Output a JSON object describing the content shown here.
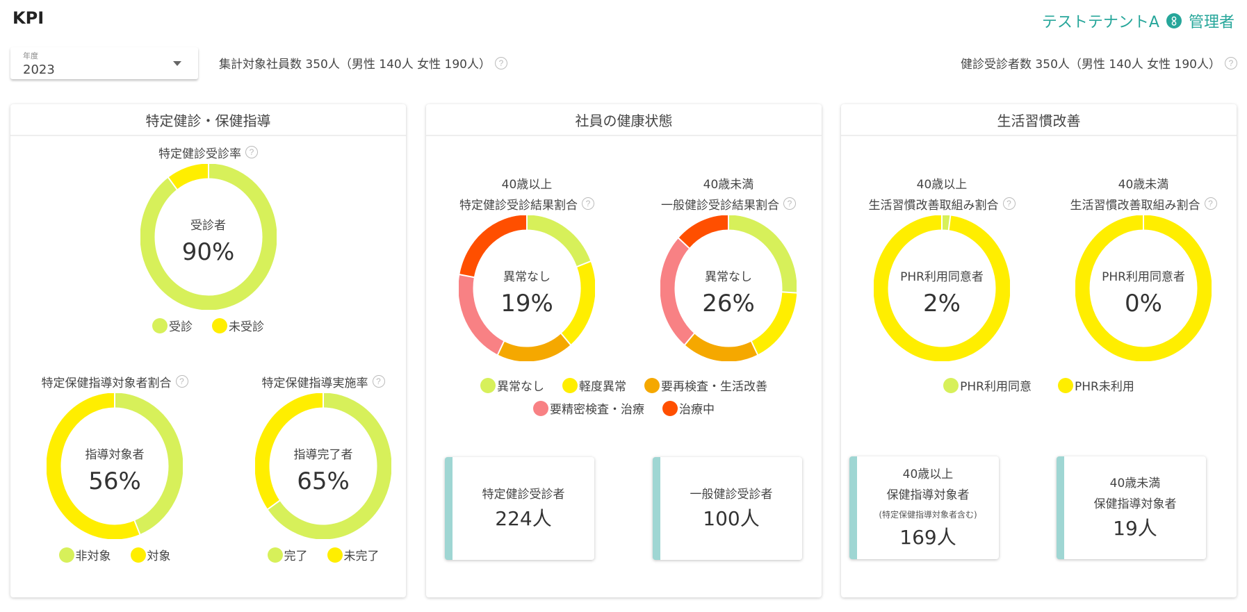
{
  "header": {
    "title": "KPI",
    "tenant": "テストテナントA",
    "role": "管理者",
    "accent_color": "#26a69a"
  },
  "year_select": {
    "label": "年度",
    "value": "2023"
  },
  "summary": {
    "target_employees": "集計対象社員数 350人（男性 140人 女性 190人）",
    "examinees": "健診受診者数 350人（男性 140人 女性 190人）"
  },
  "colors": {
    "normal": "#d7f05a",
    "mild": "#ffee00",
    "recheck": "#f5a800",
    "detailed": "#f88184",
    "treatment": "#ff4f00"
  },
  "panels": [
    {
      "title": "特定健診・保健指導",
      "charts": [
        {
          "title": "特定健診受診率",
          "center_label": "受診者",
          "center_value": "90%",
          "segments": [
            {
              "label": "受診",
              "value": 90,
              "color": "#d7f05a"
            },
            {
              "label": "未受診",
              "value": 10,
              "color": "#ffee00"
            }
          ]
        },
        {
          "title": "特定保健指導対象者割合",
          "center_label": "指導対象者",
          "center_value": "56%",
          "segments": [
            {
              "label": "非対象",
              "value": 44,
              "color": "#d7f05a"
            },
            {
              "label": "対象",
              "value": 56,
              "color": "#ffee00"
            }
          ]
        },
        {
          "title": "特定保健指導実施率",
          "center_label": "指導完了者",
          "center_value": "65%",
          "segments": [
            {
              "label": "完了",
              "value": 65,
              "color": "#d7f05a"
            },
            {
              "label": "未完了",
              "value": 35,
              "color": "#ffee00"
            }
          ]
        }
      ]
    },
    {
      "title": "社員の健康状態",
      "charts": [
        {
          "subtitle": "40歳以上",
          "title": "特定健診受診結果割合",
          "center_label": "異常なし",
          "center_value": "19%",
          "segments": [
            {
              "label": "異常なし",
              "value": 19,
              "color": "#d7f05a"
            },
            {
              "label": "軽度異常",
              "value": 20,
              "color": "#ffee00"
            },
            {
              "label": "要再検査・生活改善",
              "value": 18,
              "color": "#f5a800"
            },
            {
              "label": "要精密検査・治療",
              "value": 21,
              "color": "#f88184"
            },
            {
              "label": "治療中",
              "value": 22,
              "color": "#ff4f00"
            }
          ]
        },
        {
          "subtitle": "40歳未満",
          "title": "一般健診受診結果割合",
          "center_label": "異常なし",
          "center_value": "26%",
          "segments": [
            {
              "label": "異常なし",
              "value": 26,
              "color": "#d7f05a"
            },
            {
              "label": "軽度異常",
              "value": 17,
              "color": "#ffee00"
            },
            {
              "label": "要再検査・生活改善",
              "value": 18,
              "color": "#f5a800"
            },
            {
              "label": "要精密検査・治療",
              "value": 26,
              "color": "#f88184"
            },
            {
              "label": "治療中",
              "value": 13,
              "color": "#ff4f00"
            }
          ]
        }
      ],
      "legend": [
        "異常なし",
        "軽度異常",
        "要再検査・生活改善",
        "要精密検査・治療",
        "治療中"
      ],
      "cards": [
        {
          "label": "特定健診受診者",
          "value": "224人"
        },
        {
          "label": "一般健診受診者",
          "value": "100人"
        }
      ]
    },
    {
      "title": "生活習慣改善",
      "charts": [
        {
          "subtitle": "40歳以上",
          "title": "生活習慣改善取組み割合",
          "center_label": "PHR利用同意者",
          "center_value": "2%",
          "segments": [
            {
              "label": "PHR利用同意",
              "value": 2,
              "color": "#d7f05a"
            },
            {
              "label": "PHR未利用",
              "value": 98,
              "color": "#ffee00"
            }
          ]
        },
        {
          "subtitle": "40歳未満",
          "title": "生活習慣改善取組み割合",
          "center_label": "PHR利用同意者",
          "center_value": "0%",
          "segments": [
            {
              "label": "PHR利用同意",
              "value": 0,
              "color": "#d7f05a"
            },
            {
              "label": "PHR未利用",
              "value": 100,
              "color": "#ffee00"
            }
          ]
        }
      ],
      "legend": [
        "PHR利用同意",
        "PHR未利用"
      ],
      "cards": [
        {
          "line1": "40歳以上",
          "line2": "保健指導対象者",
          "note": "(特定保健指導対象者含む)",
          "value": "169人"
        },
        {
          "line1": "40歳未満",
          "line2": "保健指導対象者",
          "value": "19人"
        }
      ]
    }
  ],
  "help_icon": "?"
}
